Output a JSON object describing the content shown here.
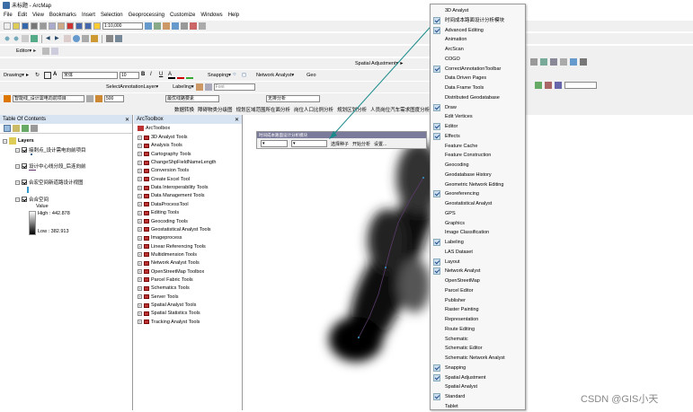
{
  "window": {
    "title": "未标题 - ArcMap"
  },
  "menubar": [
    "File",
    "Edit",
    "View",
    "Bookmarks",
    "Insert",
    "Selection",
    "Geoprocessing",
    "Customize",
    "Windows",
    "Help"
  ],
  "toolbar": {
    "scale": "1:10,000",
    "editor": "Editor▾",
    "drawing": "Drawing▾",
    "font": "宋体",
    "fontsize": "10",
    "snapping": "Snapping▾",
    "spatial_adjustment": "Spatial Adjustment▾",
    "network_analyst": "Network Analyst▾",
    "geo": "Geo",
    "select_annotation_layer": "SelectAnnotationLayer▾",
    "labeling": "Labeling▾",
    "labeling_font": "Font",
    "layer_combo": "智能线_设计需电向前项目",
    "zoom": "500",
    "nav_combo_a": "最优线路要素",
    "nav_combo_b": "无排分析",
    "tools_row": [
      "数据转换",
      "障碍物类分级图",
      "规划区域范围所在面分析",
      "岗位人口比例分析",
      "规划区划分析",
      "人员岗位汽车需求图度分析",
      "屋包里..."
    ],
    "right_row": [
      "公共汽车分析",
      "公交汽车可达性分析",
      "精益度计算",
      "Kmeans聚类分析"
    ],
    "icons": [
      "new-icon",
      "open-icon",
      "save-icon",
      "print-icon",
      "cut-icon",
      "copy-icon",
      "paste-icon",
      "delete-icon",
      "undo-icon",
      "redo-icon",
      "add-data-icon"
    ]
  },
  "toc": {
    "title": "Table Of Contents",
    "root": "Layers",
    "layers": [
      "接刺点_设计需电向前项目",
      "设计中心线分段_后连向前",
      "合宏空间新道路设计视图",
      "合合空间"
    ],
    "legend_title": "Value",
    "high": "High : 442.878",
    "low": "Low : 382.913"
  },
  "arctoolbox": {
    "title": "ArcToolbox",
    "root": "ArcToolbox",
    "items": [
      "3D Analyst Tools",
      "Analysis Tools",
      "Cartography Tools",
      "ChangeShpFieldNameLength",
      "Conversion Tools",
      "Create Excel Tool",
      "Data Interoperability Tools",
      "Data Management Tools",
      "DataProcessTool",
      "Editing Tools",
      "Geocoding Tools",
      "Geostatistical Analyst Tools",
      "Imageprocess",
      "Linear Referencing Tools",
      "Multidimension Tools",
      "Network Analyst Tools",
      "OpenStreetMap Toolbox",
      "Parcel Fabric Tools",
      "Schematics Tools",
      "Server Tools",
      "Spatial Analyst Tools",
      "Spatial Statistics Tools",
      "Tracking Analyst Tools"
    ]
  },
  "dock": {
    "title": "时间成本路面设计分析模块",
    "buttons": [
      "选择种子",
      "开始分析",
      "设置..."
    ]
  },
  "context_menu": {
    "items": [
      {
        "label": "3D Analyst",
        "checked": false
      },
      {
        "label": "时间成本路面设计分析模块",
        "checked": true
      },
      {
        "label": "Advanced Editing",
        "checked": true
      },
      {
        "label": "Animation",
        "checked": false
      },
      {
        "label": "ArcScan",
        "checked": false
      },
      {
        "label": "COGO",
        "checked": false
      },
      {
        "label": "CorrectAnnotationToolbar",
        "checked": true
      },
      {
        "label": "Data Driven Pages",
        "checked": false
      },
      {
        "label": "Data Frame Tools",
        "checked": false
      },
      {
        "label": "Distributed Geodatabase",
        "checked": false
      },
      {
        "label": "Draw",
        "checked": true
      },
      {
        "label": "Edit Vertices",
        "checked": false
      },
      {
        "label": "Editor",
        "checked": true
      },
      {
        "label": "Effects",
        "checked": true
      },
      {
        "label": "Feature Cache",
        "checked": false
      },
      {
        "label": "Feature Construction",
        "checked": false
      },
      {
        "label": "Geocoding",
        "checked": false
      },
      {
        "label": "Geodatabase History",
        "checked": false
      },
      {
        "label": "Geometric Network Editing",
        "checked": false
      },
      {
        "label": "Georeferencing",
        "checked": true
      },
      {
        "label": "Geostatistical Analyst",
        "checked": false
      },
      {
        "label": "GPS",
        "checked": false
      },
      {
        "label": "Graphics",
        "checked": false
      },
      {
        "label": "Image Classification",
        "checked": false
      },
      {
        "label": "Labeling",
        "checked": true
      },
      {
        "label": "LAS Dataset",
        "checked": false
      },
      {
        "label": "Layout",
        "checked": true
      },
      {
        "label": "Network Analyst",
        "checked": true
      },
      {
        "label": "OpenStreetMap",
        "checked": false
      },
      {
        "label": "Parcel Editor",
        "checked": false
      },
      {
        "label": "Publisher",
        "checked": false
      },
      {
        "label": "Raster Painting",
        "checked": false
      },
      {
        "label": "Representation",
        "checked": false
      },
      {
        "label": "Route Editing",
        "checked": false
      },
      {
        "label": "Schematic",
        "checked": false
      },
      {
        "label": "Schematic Editor",
        "checked": false
      },
      {
        "label": "Schematic Network Analyst",
        "checked": false
      },
      {
        "label": "Snapping",
        "checked": true
      },
      {
        "label": "Spatial Adjustment",
        "checked": true
      },
      {
        "label": "Spatial Analyst",
        "checked": false
      },
      {
        "label": "Standard",
        "checked": true
      },
      {
        "label": "Tablet",
        "checked": false
      }
    ]
  },
  "watermark": "CSDN @GIS小天",
  "colors": {
    "accent": "#1a8a8a",
    "menu_bg": "#f7f7f7",
    "panel_header": "#d9e4f2"
  }
}
